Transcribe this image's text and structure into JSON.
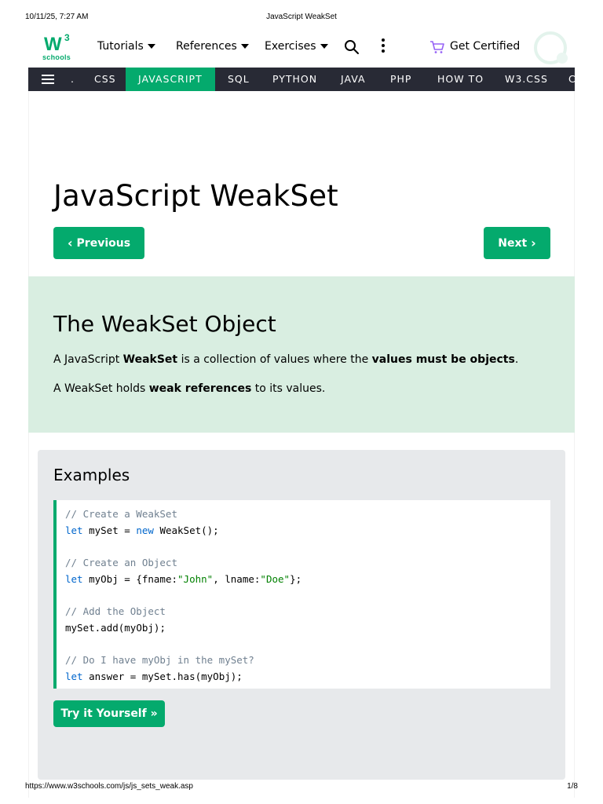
{
  "print_header": {
    "timestamp": "10/11/25, 7:27 AM",
    "title": "JavaScript WeakSet"
  },
  "logo": {
    "mark": "W",
    "sup": "3",
    "text": "schools"
  },
  "topnav": {
    "tutorials": "Tutorials",
    "references": "References",
    "exercises": "Exercises",
    "get_certified": "Get Certified"
  },
  "subnav": {
    "items": [
      ".",
      "CSS",
      "JAVASCRIPT",
      "SQL",
      "PYTHON",
      "JAVA",
      "PHP",
      "HOW TO",
      "W3.CSS",
      "C"
    ],
    "active": "JAVASCRIPT"
  },
  "page": {
    "title": "JavaScript WeakSet",
    "prev_label": "Previous",
    "next_label": "Next"
  },
  "intro": {
    "heading": "The WeakSet Object",
    "p1": {
      "a": "A JavaScript ",
      "b": "WeakSet",
      "c": " is a collection of values where the ",
      "d": "values must be objects",
      "e": "."
    },
    "p2": {
      "a": "A WeakSet holds ",
      "b": "weak references",
      "c": " to its values."
    }
  },
  "examples": {
    "heading": "Examples",
    "code": [
      "// Create a WeakSet",
      "let mySet = new WeakSet();",
      "",
      "// Create an Object",
      "let myObj = {fname:\"John\", lname:\"Doe\"};",
      "",
      "// Add the Object",
      "mySet.add(myObj);",
      "",
      "// Do I have myObj in the mySet?",
      "let answer = mySet.has(myObj);"
    ],
    "try_label": "Try it Yourself »"
  },
  "print_footer": {
    "url": "https://www.w3schools.com/js/js_sets_weak.asp",
    "page": "1/8"
  },
  "colors": {
    "brand_green": "#04AA6D",
    "subnav_bg": "#282A35",
    "intro_bg": "#D9EEE1",
    "examples_bg": "#E7E9EB"
  }
}
